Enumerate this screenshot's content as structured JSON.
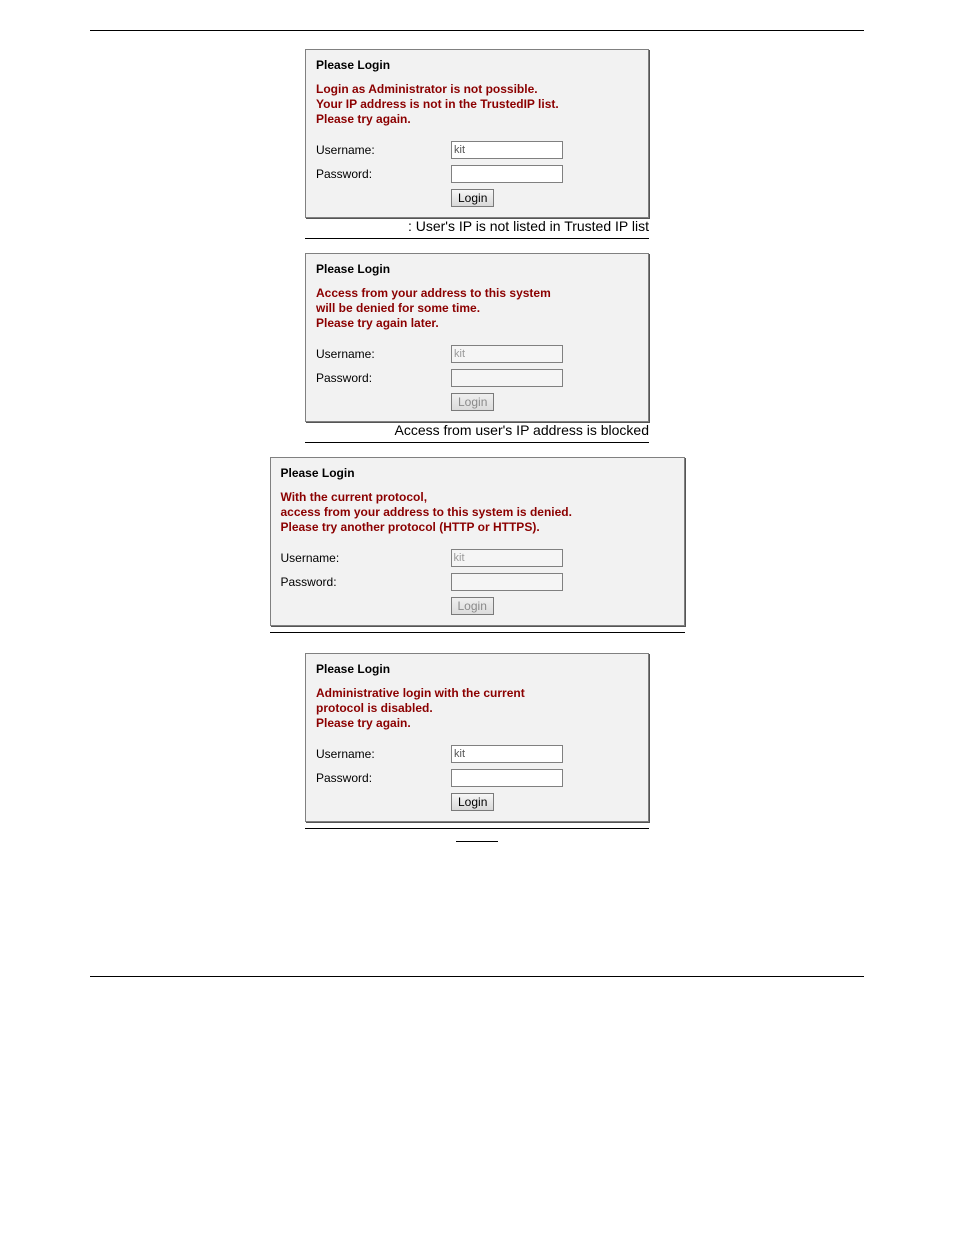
{
  "figures": [
    {
      "title": "Please Login",
      "error": "Login as Administrator is not possible.\nYour IP address is not in the TrustedIP list.\nPlease try again.",
      "username_label": "Username:",
      "password_label": "Password:",
      "username_value": "kit",
      "login_label": "Login",
      "disabled": false,
      "caption": ": User's IP is not listed in Trusted IP list"
    },
    {
      "title": "Please Login",
      "error": "Access from your address to this system\nwill be denied for some time.\nPlease try again later.",
      "username_label": "Username:",
      "password_label": "Password:",
      "username_value": "kit",
      "login_label": "Login",
      "disabled": true,
      "caption": "Access from user's IP address is blocked"
    },
    {
      "title": "Please Login",
      "error": "With the current protocol,\naccess from your address to this system is denied.\nPlease try another protocol (HTTP or HTTPS).",
      "username_label": "Username:",
      "password_label": "Password:",
      "username_value": "kit",
      "login_label": "Login",
      "disabled": true,
      "caption": ""
    },
    {
      "title": "Please Login",
      "error": "Administrative login with the current\nprotocol is disabled.\nPlease try again.",
      "username_label": "Username:",
      "password_label": "Password:",
      "username_value": "kit",
      "login_label": "Login",
      "disabled": false,
      "caption": ""
    }
  ]
}
